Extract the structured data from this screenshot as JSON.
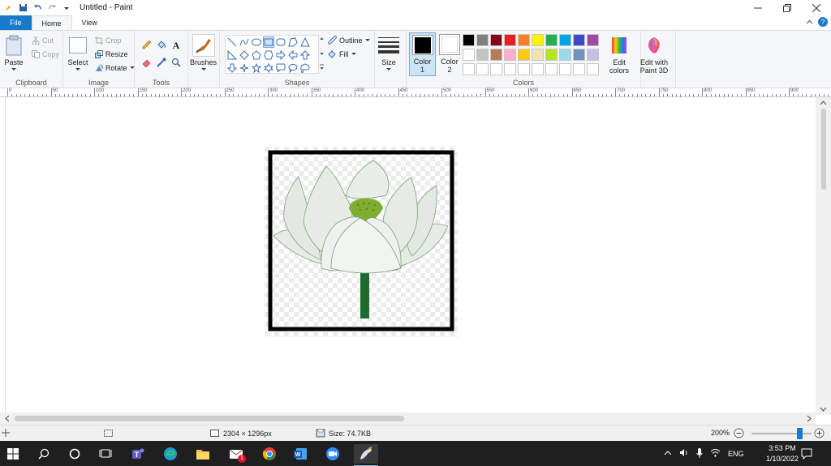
{
  "window": {
    "title": "Untitled - Paint"
  },
  "tabs": [
    {
      "label": "File"
    },
    {
      "label": "Home"
    },
    {
      "label": "View"
    }
  ],
  "ribbon": {
    "clipboard": {
      "group_label": "Clipboard",
      "paste": "Paste",
      "cut": "Cut",
      "copy": "Copy"
    },
    "image": {
      "group_label": "Image",
      "select": "Select",
      "crop": "Crop",
      "resize": "Resize",
      "rotate": "Rotate"
    },
    "tools": {
      "group_label": "Tools",
      "brushes": "Brushes"
    },
    "shapes": {
      "group_label": "Shapes",
      "outline": "Outline",
      "fill": "Fill"
    },
    "size": {
      "label": "Size"
    },
    "colors": {
      "group_label": "Colors",
      "color1": "Color 1",
      "color2": "Color 2",
      "edit_colors": "Edit colors",
      "edit_paint3d": "Edit with Paint 3D",
      "color1_value": "#000000",
      "color2_value": "#ffffff",
      "palette_row1": [
        "#000000",
        "#7f7f7f",
        "#880015",
        "#ed1c24",
        "#ff7f27",
        "#fff200",
        "#22b14c",
        "#00a2e8",
        "#3f48cc",
        "#a349a4"
      ],
      "palette_row2": [
        "#ffffff",
        "#c3c3c3",
        "#b97a57",
        "#ffaec9",
        "#ffc90e",
        "#efe4b0",
        "#b5e61d",
        "#99d9ea",
        "#7092be",
        "#c8bfe7"
      ],
      "palette_row3": [
        "#ffffff",
        "#ffffff",
        "#ffffff",
        "#ffffff",
        "#ffffff",
        "#ffffff",
        "#ffffff",
        "#ffffff",
        "#ffffff",
        "#ffffff"
      ]
    }
  },
  "ruler": {
    "labels": [
      "0",
      "50",
      "100",
      "150",
      "200",
      "250",
      "300",
      "350",
      "400",
      "450",
      "500",
      "550",
      "600",
      "650",
      "700",
      "750",
      "800",
      "850",
      "900"
    ]
  },
  "statusbar": {
    "dimensions": "2304 × 1296px",
    "size": "Size: 74.7KB",
    "zoom": "200%",
    "zoom_level": 0.8
  },
  "taskbar": {
    "mail_badge": "1",
    "time": "3:53 PM",
    "date": "1/10/2022",
    "language": "ENG"
  }
}
